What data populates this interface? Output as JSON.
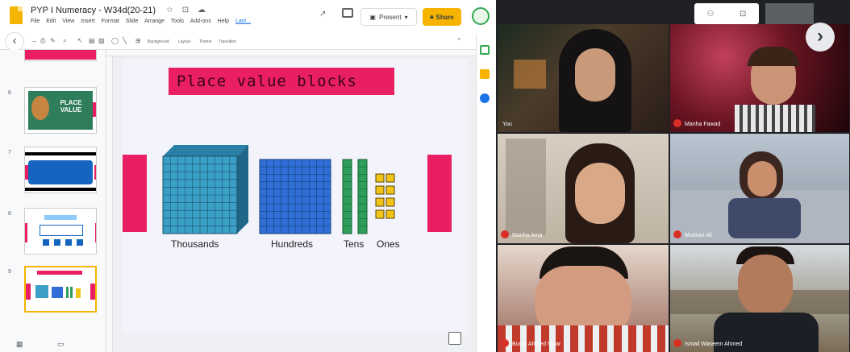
{
  "slides_app": {
    "doc_title": "PYP I Numeracy - W34d(20-21)",
    "menu": [
      "File",
      "Edit",
      "View",
      "Insert",
      "Format",
      "Slide",
      "Arrange",
      "Tools",
      "Add-ons",
      "Help"
    ],
    "last_edit": "Last...",
    "present_label": "Present",
    "share_label": "Share",
    "toolbar": {
      "background_label": "Background",
      "layout_label": "Layout",
      "theme_label": "Theme",
      "transition_label": "Transition"
    },
    "thumbnails": [
      {
        "number": "",
        "caption": "",
        "selected": false
      },
      {
        "number": "6",
        "caption": "PLACE VALUE",
        "selected": false
      },
      {
        "number": "7",
        "caption": "",
        "selected": false
      },
      {
        "number": "8",
        "caption": "",
        "selected": false
      },
      {
        "number": "9",
        "caption": "",
        "selected": true
      }
    ],
    "slide": {
      "title": "Place value blocks",
      "labels": {
        "thousands": "Thousands",
        "hundreds": "Hundreds",
        "tens": "Tens",
        "ones": "Ones"
      },
      "colors": {
        "accent": "#e91e63",
        "thousands": "#3aa0c8",
        "hundreds": "#2f6fd6",
        "tens": "#2e9e5b",
        "ones": "#f2c418"
      }
    }
  },
  "meet": {
    "participants": [
      {
        "name": "You"
      },
      {
        "name": "Manha Fawad"
      },
      {
        "name": "Manha Ama"
      },
      {
        "name": "Muskan Ali"
      },
      {
        "name": "Burak Ahmed Nizar"
      },
      {
        "name": "Ismail Waseem Ahmed"
      }
    ]
  }
}
